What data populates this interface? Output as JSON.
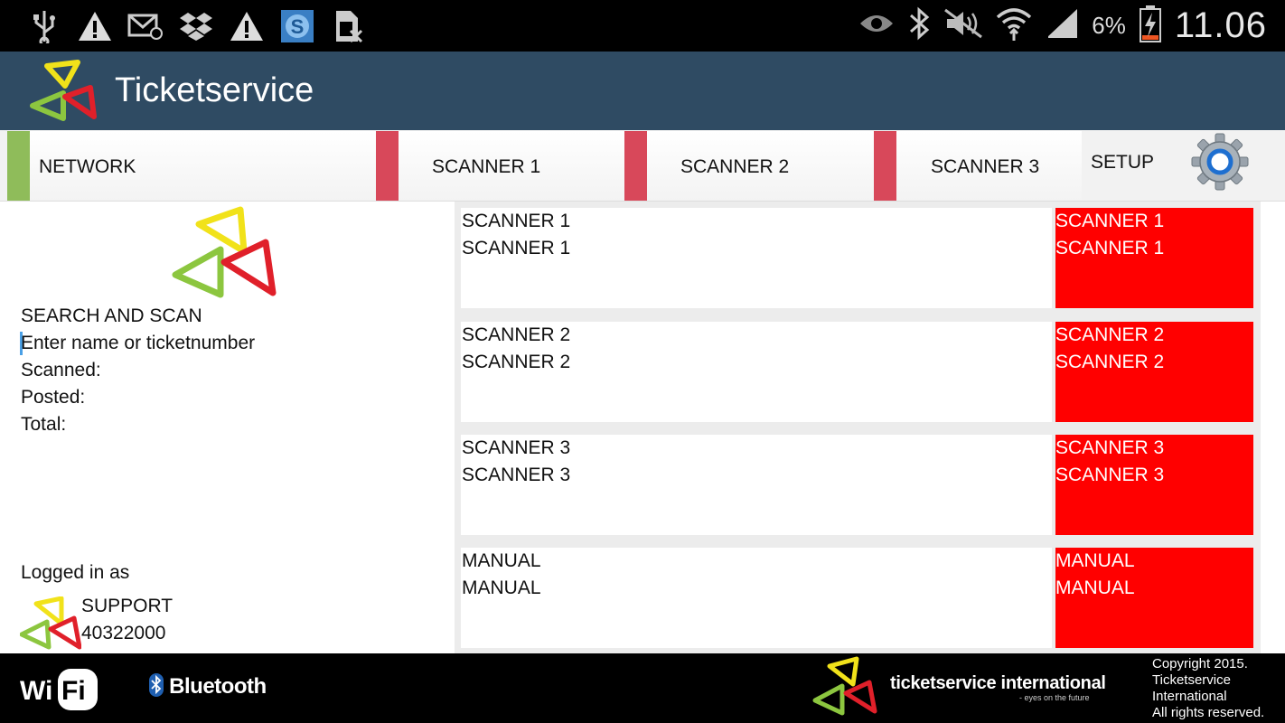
{
  "status_bar": {
    "left_icons": [
      "usb-icon",
      "warning-icon",
      "email-icon",
      "dropbox-icon",
      "warning-icon",
      "skype-icon",
      "sim-card-icon"
    ],
    "right_icons": [
      "eye-icon",
      "bluetooth-icon",
      "mute-icon",
      "wifi-signal-icon",
      "cell-signal-icon",
      "battery-charging-icon"
    ],
    "battery": "6%",
    "clock": "11.06"
  },
  "app": {
    "title": "Ticketservice"
  },
  "tabs": [
    {
      "label": "NETWORK",
      "stripe_color": "#8fbc5a"
    },
    {
      "label": "SCANNER 1",
      "stripe_color": "#d8485a"
    },
    {
      "label": "SCANNER 2",
      "stripe_color": "#d8485a"
    },
    {
      "label": "SCANNER 3",
      "stripe_color": "#d8485a"
    }
  ],
  "setup": {
    "label": "SETUP"
  },
  "left_panel": {
    "heading": "SEARCH AND SCAN",
    "search_placeholder": "Enter name or ticketnumber",
    "scanned_label": "Scanned:",
    "posted_label": "Posted:",
    "total_label": "Total:",
    "logged_in_label": "Logged in as",
    "user_name": "SUPPORT",
    "user_id": "40322000"
  },
  "scanners": [
    {
      "left_line1": "SCANNER 1",
      "left_line2": "SCANNER 1",
      "right_line1": "SCANNER 1",
      "right_line2": "SCANNER 1"
    },
    {
      "left_line1": "SCANNER 2",
      "left_line2": "SCANNER 2",
      "right_line1": "SCANNER 2",
      "right_line2": "SCANNER 2"
    },
    {
      "left_line1": "SCANNER 3",
      "left_line2": "SCANNER 3",
      "right_line1": "SCANNER 3",
      "right_line2": "SCANNER 3"
    },
    {
      "left_line1": "MANUAL",
      "left_line2": "MANUAL",
      "right_line1": "MANUAL",
      "right_line2": "MANUAL"
    }
  ],
  "footer": {
    "wifi_text": "Wi Fi",
    "bluetooth_text": "Bluetooth",
    "brand_name": "ticketservice international",
    "brand_tagline": "- eyes on the future",
    "copyright_lines": [
      "Copyright 2015.",
      "Ticketservice",
      "International",
      "All rights reserved."
    ]
  },
  "colors": {
    "status_red": "#ff0000",
    "action_bar": "#2f4b63",
    "logo_yellow": "#f1e21a",
    "logo_green": "#8cc63f",
    "logo_red": "#e0202a"
  }
}
